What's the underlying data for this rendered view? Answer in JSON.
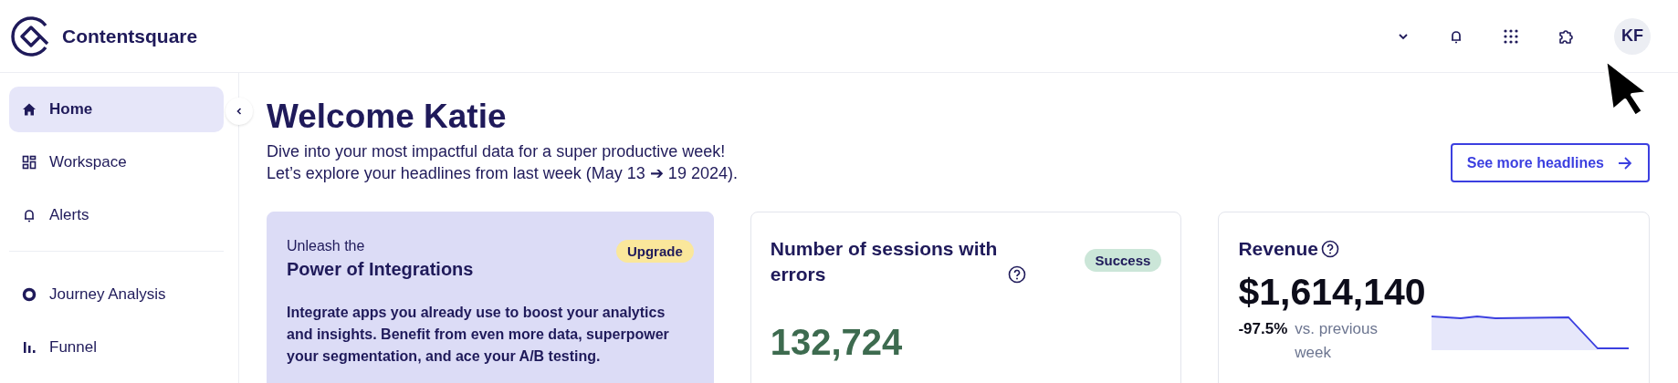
{
  "header": {
    "logo_text": "Contentsquare",
    "avatar": "KF"
  },
  "sidebar": {
    "groups": [
      {
        "items": [
          {
            "label": "Home",
            "selected": true
          },
          {
            "label": "Workspace",
            "selected": false
          },
          {
            "label": "Alerts",
            "selected": false
          }
        ]
      },
      {
        "items": [
          {
            "label": "Journey Analysis",
            "selected": false
          },
          {
            "label": "Funnel",
            "selected": false
          }
        ]
      }
    ]
  },
  "main": {
    "title": "Welcome Katie",
    "subtitle": [
      "Dive into your most impactful data for a super productive week!",
      "Let’s explore your headlines from last week (May 13 ➔ 19 2024)."
    ],
    "button": "See more headlines",
    "cards": [
      {
        "kind": "promo",
        "eyebrow": "Unleash the",
        "title": "Power of Integrations",
        "badge": "Upgrade",
        "body": "Integrate apps you already use to boost your analytics and insights. Benefit from even more data, superpower your segmentation, and ace your A/B testing."
      },
      {
        "kind": "metric",
        "title": "Number of sessions with errors",
        "badge": "Success",
        "value": "132,724"
      },
      {
        "kind": "trend",
        "title": "Revenue",
        "value": "$1,614,140",
        "change": "-97.5%",
        "comparison": "vs. previous week"
      }
    ]
  }
}
